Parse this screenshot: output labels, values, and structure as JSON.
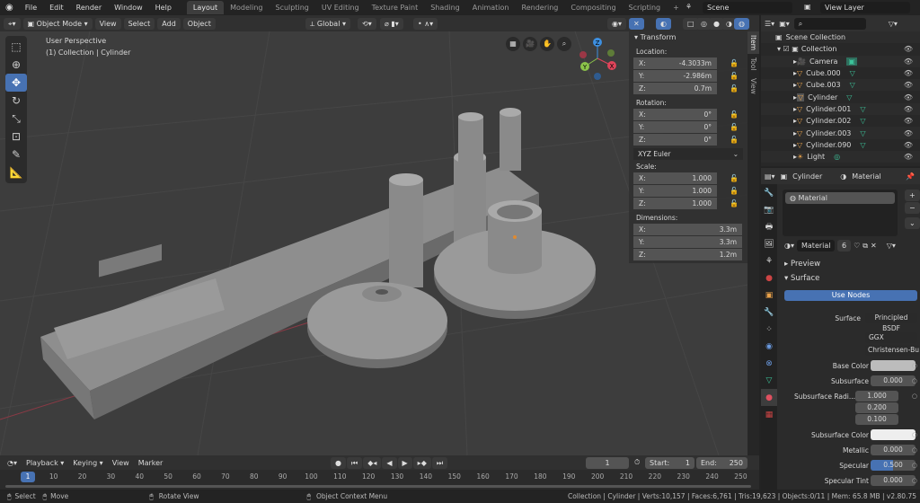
{
  "topbar": {
    "menu": [
      "File",
      "Edit",
      "Render",
      "Window",
      "Help"
    ],
    "workspaces": [
      "Layout",
      "Modeling",
      "Sculpting",
      "UV Editing",
      "Texture Paint",
      "Shading",
      "Animation",
      "Rendering",
      "Compositing",
      "Scripting"
    ],
    "active_workspace": "Layout",
    "add_tab": "+",
    "scene": "Scene",
    "view_layer": "View Layer"
  },
  "viewport_header": {
    "mode": "Object Mode",
    "menus": [
      "View",
      "Select",
      "Add",
      "Object"
    ],
    "orientation": "Global"
  },
  "viewport": {
    "perspective": "User Perspective",
    "context": "(1) Collection | Cylinder",
    "gizmo": {
      "x": "X",
      "y": "Y",
      "z": "Z"
    },
    "x_axis_color": "#e0445a",
    "y_axis_color": "#8bc34a",
    "z_axis_color": "#3d8fe0"
  },
  "transform": {
    "title": "Transform",
    "location_label": "Location:",
    "location": [
      {
        "a": "X:",
        "v": "-4.3033m"
      },
      {
        "a": "Y:",
        "v": "-2.986m"
      },
      {
        "a": "Z:",
        "v": "0.7m"
      }
    ],
    "rotation_label": "Rotation:",
    "rotation": [
      {
        "a": "X:",
        "v": "0°"
      },
      {
        "a": "Y:",
        "v": "0°"
      },
      {
        "a": "Z:",
        "v": "0°"
      }
    ],
    "rotation_mode": "XYZ Euler",
    "scale_label": "Scale:",
    "scale": [
      {
        "a": "X:",
        "v": "1.000"
      },
      {
        "a": "Y:",
        "v": "1.000"
      },
      {
        "a": "Z:",
        "v": "1.000"
      }
    ],
    "dimensions_label": "Dimensions:",
    "dimensions": [
      {
        "a": "X:",
        "v": "3.3m"
      },
      {
        "a": "Y:",
        "v": "3.3m"
      },
      {
        "a": "Z:",
        "v": "1.2m"
      }
    ]
  },
  "sidebar_tabs": [
    "Item",
    "Tool",
    "View"
  ],
  "outliner": {
    "root": "Scene Collection",
    "collection": "Collection",
    "items": [
      "Camera",
      "Cube.000",
      "Cube.003",
      "Cylinder",
      "Cylinder.001",
      "Cylinder.002",
      "Cylinder.003",
      "Cylinder.090",
      "Light"
    ],
    "selected": "Cylinder"
  },
  "properties": {
    "object": "Cylinder",
    "tab": "Material",
    "slot": "Material",
    "material_name": "Material",
    "users": "6",
    "preview": "Preview",
    "surface_panel": "Surface",
    "use_nodes": "Use Nodes",
    "surface_label": "Surface",
    "surface_value": "Principled BSDF",
    "distribution": "GGX",
    "subsurface_method": "Christensen-Bur...",
    "fields": [
      {
        "label": "Base Color",
        "value": "",
        "color": "#bcbcbc"
      },
      {
        "label": "Subsurface",
        "value": "0.000"
      },
      {
        "label": "Subsurface Radi...",
        "values": [
          "1.000",
          "0.200",
          "0.100"
        ]
      },
      {
        "label": "Subsurface Color",
        "value": "",
        "color": "#eeeeee"
      },
      {
        "label": "Metallic",
        "value": "0.000"
      },
      {
        "label": "Specular",
        "value": "0.500",
        "fill": 0.5
      },
      {
        "label": "Specular Tint",
        "value": "0.000"
      }
    ]
  },
  "timeline": {
    "menus": [
      "Playback",
      "Keying",
      "View",
      "Marker"
    ],
    "current_frame": "1",
    "start_label": "Start:",
    "start": "1",
    "end_label": "End:",
    "end": "250",
    "ticks": [
      "1",
      "10",
      "20",
      "30",
      "40",
      "50",
      "60",
      "70",
      "80",
      "90",
      "100",
      "110",
      "120",
      "130",
      "140",
      "150",
      "160",
      "170",
      "180",
      "190",
      "200",
      "210",
      "220",
      "230",
      "240",
      "250"
    ]
  },
  "status": {
    "select": "Select",
    "move": "Move",
    "rotate": "Rotate View",
    "context_menu": "Object Context Menu",
    "stats": "Collection | Cylinder | Verts:10,157 | Faces:6,761 | Tris:19,623 | Objects:0/11 | Mem: 65.8 MB | v2.80.75"
  },
  "accent": "#4772b3"
}
